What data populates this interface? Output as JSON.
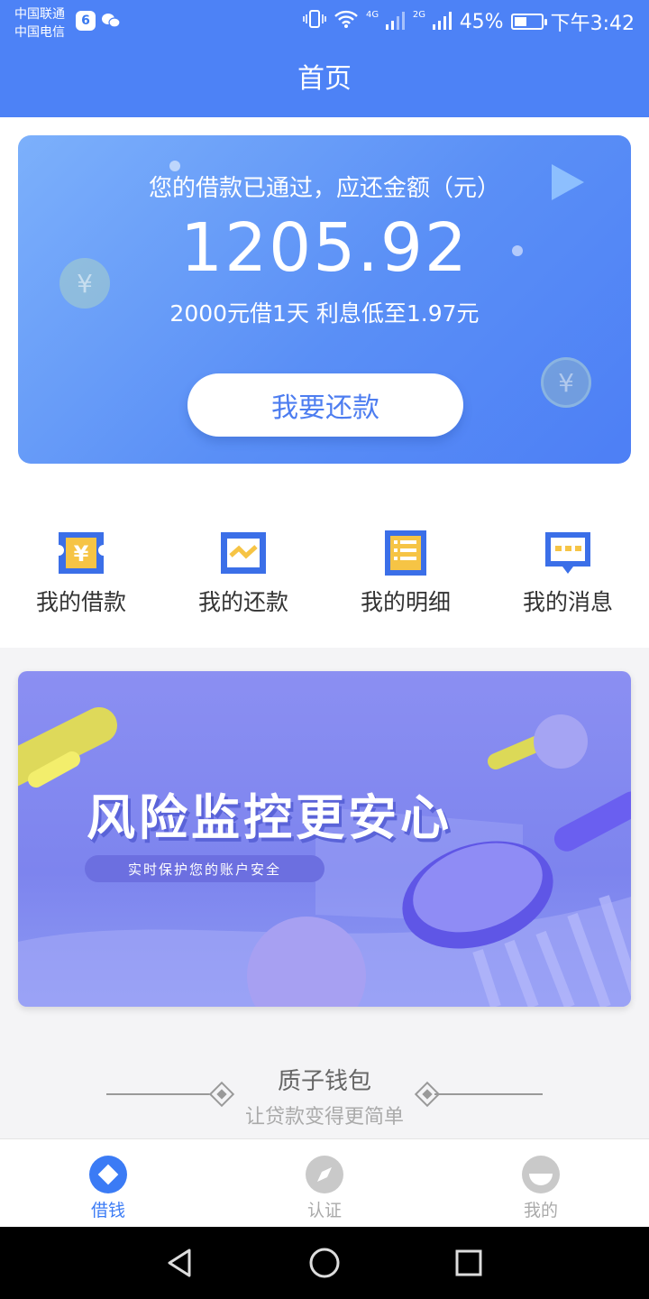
{
  "status_bar": {
    "carrier_1": "中国联通",
    "carrier_2": "中国电信",
    "app_badge": "6",
    "network_1": "4G",
    "network_2": "2G",
    "battery": "45%",
    "battery_level": 0.45,
    "time": "下午3:42"
  },
  "header": {
    "title": "首页"
  },
  "loan_card": {
    "caption": "您的借款已通过，应还金额（元）",
    "amount": "1205.92",
    "subtitle": "2000元借1天 利息低至1.97元",
    "button_label": "我要还款",
    "coin_symbol": "¥"
  },
  "quick_actions": [
    {
      "label": "我的借款",
      "icon": "ticket-yen-icon"
    },
    {
      "label": "我的还款",
      "icon": "repay-chart-icon"
    },
    {
      "label": "我的明细",
      "icon": "detail-list-icon"
    },
    {
      "label": "我的消息",
      "icon": "message-icon"
    }
  ],
  "banner": {
    "title": "风险监控更安心",
    "subtitle": "实时保护您的账户安全"
  },
  "brand": {
    "name": "质子钱包",
    "slogan": "让贷款变得更简单"
  },
  "tabs": [
    {
      "label": "借钱",
      "icon": "diamond-icon",
      "active": true
    },
    {
      "label": "认证",
      "icon": "compass-icon",
      "active": false
    },
    {
      "label": "我的",
      "icon": "profile-icon",
      "active": false
    }
  ],
  "colors": {
    "primary": "#4d82f6",
    "accent_yellow": "#f6c445",
    "icon_blue": "#3b6fe8",
    "banner": "#8087ef"
  }
}
